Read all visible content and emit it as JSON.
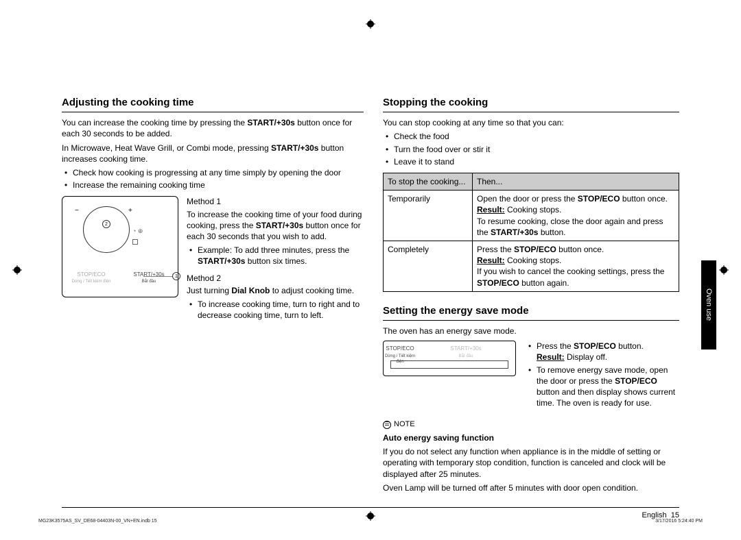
{
  "side_tab": "Oven use",
  "left": {
    "heading": "Adjusting the cooking time",
    "p1a": "You can increase the cooking time by pressing the ",
    "p1b": "START/+30s",
    "p1c": " button once for each 30 seconds to be added.",
    "p2a": "In Microwave, Heat Wave Grill, or Combi mode, pressing ",
    "p2b": "START/+30s",
    "p2c": " button increases cooking time.",
    "b1": "Check how cooking is progressing at any time simply by opening the door",
    "b2": "Increase the remaining cooking time",
    "fig": {
      "minus": "−",
      "plus": "+",
      "num1": "1",
      "num2": "2",
      "stop": "STOP/ECO",
      "stop_sub": "Dừng / Tiết kiệm điện",
      "start": "START/+30s",
      "start_sub": "Bắt đầu"
    },
    "m1_h": "Method 1",
    "m1_p1a": "To increase the cooking time of your food during cooking, press the ",
    "m1_p1b": "START/+30s",
    "m1_p1c": " button once for each 30 seconds that you wish to add.",
    "m1_ex_a": "Example: To add three minutes, press the ",
    "m1_ex_b": "START/+30s",
    "m1_ex_c": " button six times.",
    "m2_h": "Method 2",
    "m2_p_a": "Just turning ",
    "m2_p_b": "Dial Knob",
    "m2_p_c": " to adjust cooking time.",
    "m2_b": "To increase cooking time, turn to right and to decrease cooking time, turn to left."
  },
  "right": {
    "h1": "Stopping the cooking",
    "p1": "You can stop cooking at any time so that you can:",
    "b1": "Check the food",
    "b2": "Turn the food over or stir it",
    "b3": "Leave it to stand",
    "th1": "To stop the cooking...",
    "th2": "Then...",
    "r1c1": "Temporarily",
    "r1_l1a": "Open the door or press the ",
    "r1_l1b": "STOP/ECO",
    "r1_l1c": " button once.",
    "r1_l2a": "Result:",
    "r1_l2b": "   Cooking stops.",
    "r1_l3a": "To resume cooking, close the door again and press the ",
    "r1_l3b": "START/+30s",
    "r1_l3c": " button.",
    "r2c1": "Completely",
    "r2_l1a": "Press the ",
    "r2_l1b": "STOP/ECO",
    "r2_l1c": " button once.",
    "r2_l2a": "Result:",
    "r2_l2b": "   Cooking stops.",
    "r2_l3a": "If you wish to cancel the cooking settings, press the ",
    "r2_l3b": "STOP/ECO",
    "r2_l3c": " button again.",
    "h2": "Setting the energy save mode",
    "e_p1": "The oven has an energy save mode.",
    "efig": {
      "stop": "STOP/ECO",
      "stop_sub": "Dừng / Tiết kiệm điện",
      "start": "START/+30s",
      "start_sub": "Bắt đầu"
    },
    "e_b1a": "Press the ",
    "e_b1b": "STOP/ECO",
    "e_b1c": " button.",
    "e_b1_ra": "Result:",
    "e_b1_rb": "     Display off.",
    "e_b2a": "To remove energy save mode, open the door or press the ",
    "e_b2b": "STOP/ECO",
    "e_b2c": " button and then display shows current time. The oven is ready for use.",
    "note_h": "NOTE",
    "note_t": "Auto energy saving function",
    "note_p1": "If you do not select any function when appliance is in the middle of setting or operating with temporary stop condition, function is canceled and clock will be displayed after 25 minutes.",
    "note_p2": "Oven Lamp will be turned off after 5 minutes with door open condition."
  },
  "footer": {
    "lang": "English",
    "page": "15",
    "file": "MG23K3575AS_SV_DE68-04403N-00_VN+EN.indb   15",
    "date": "3/17/2016   5:24:40 PM"
  }
}
